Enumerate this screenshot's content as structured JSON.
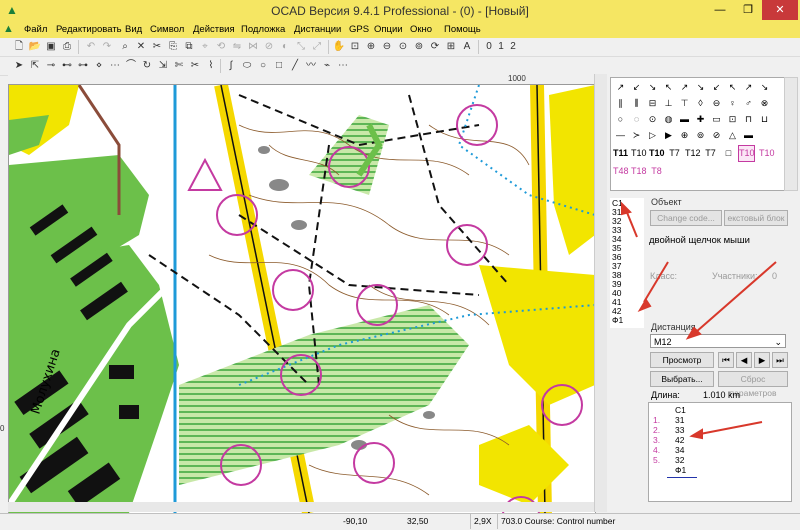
{
  "window": {
    "title": "OCAD Версия 9.4.1  Professional  -  (0)  - [Новый]",
    "app_icon": "ocad-logo-icon",
    "minimize": "—",
    "restore": "❐",
    "close": "✕"
  },
  "menu": [
    "Файл",
    "Редактировать",
    "Вид",
    "Символ",
    "Действия",
    "Подложка",
    "Дистанции",
    "GPS",
    "Опции",
    "Окно",
    "Помощь"
  ],
  "toolbar": {
    "mode_buttons": [
      "0",
      "1",
      "2"
    ]
  },
  "rulers": {
    "top_label": "1000",
    "left_label": "0"
  },
  "symbols": {
    "selected": "T10",
    "text_row1": [
      "T11",
      "T10",
      "T10",
      "T7",
      "T12",
      "T7",
      "T8",
      "T10"
    ],
    "text_row2": [
      "T48",
      "T18",
      "T8"
    ]
  },
  "controls_list": [
    "C1",
    "31",
    "32",
    "33",
    "34",
    "35",
    "36",
    "37",
    "38",
    "39",
    "40",
    "41",
    "42",
    "Ф1"
  ],
  "object_panel": {
    "group_label": "Объект",
    "change_code_button": "Change code...",
    "text_block_button": "екстовый блок",
    "class_label": "Класс:",
    "participants_label": "Участники:",
    "participants_value": "0"
  },
  "annotation": {
    "double_click_text": "двойной щелчок мыши"
  },
  "course_panel": {
    "group_label": "Дистанция",
    "selected_course": "М12",
    "preview_button": "Просмотр",
    "select_button": "Выбрать...",
    "reset_params_button": "Сброс параметров",
    "length_label": "Длина:",
    "length_value": "1.010 km",
    "course_lines": [
      {
        "num": "",
        "code": "C1"
      },
      {
        "num": "1.",
        "code": "31"
      },
      {
        "num": "2.",
        "code": "33"
      },
      {
        "num": "3.",
        "code": "42"
      },
      {
        "num": "4.",
        "code": "34"
      },
      {
        "num": "5.",
        "code": "32"
      },
      {
        "num": "",
        "code": "Ф1"
      }
    ],
    "colors": {
      "numbers": "#c43aa1",
      "underline": "#2233aa"
    }
  },
  "map": {
    "street_label": "Молухина",
    "colors": {
      "open": "#f2e500",
      "forest_green": "#6cc04a",
      "course": "#c43aa1",
      "water": "#1e9ad8",
      "road": "#f5d800",
      "contour": "#8b5a2b"
    }
  },
  "status": {
    "coords_x": "-90,10",
    "coords_y": "32,50",
    "zoom": "2,9X",
    "info": "703.0 Course: Control number"
  }
}
